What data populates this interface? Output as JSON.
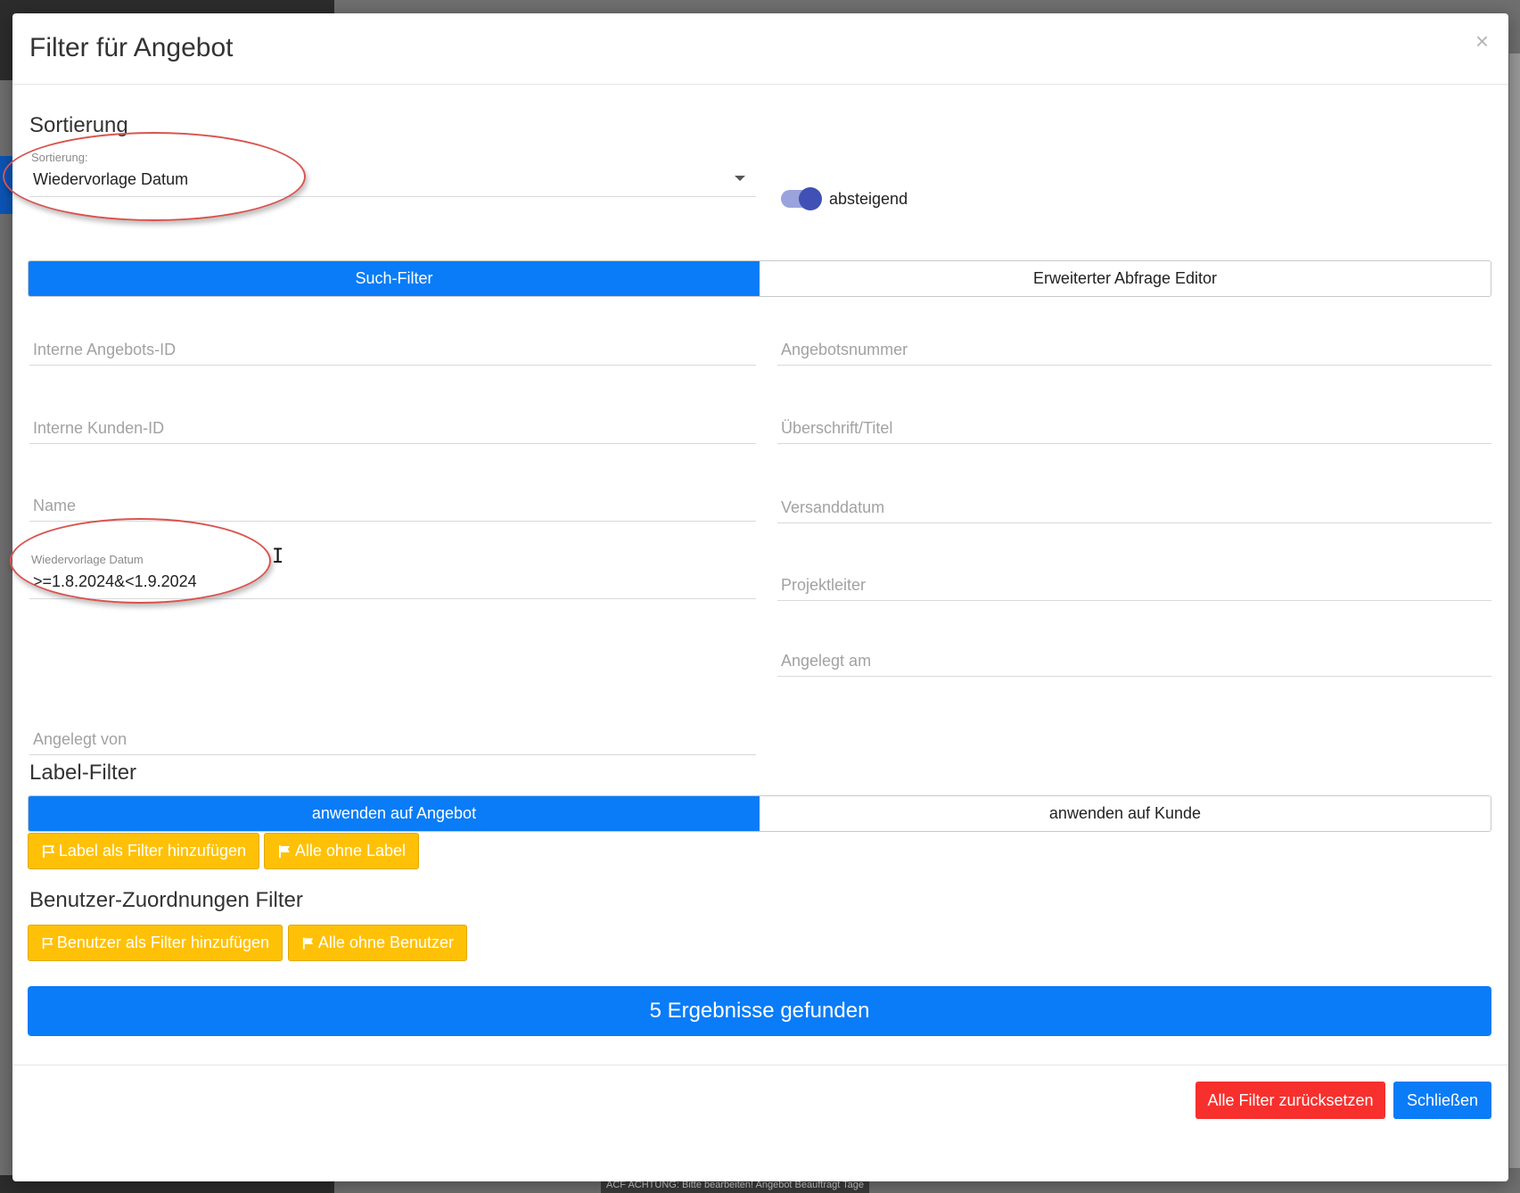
{
  "modal": {
    "title": "Filter für Angebot",
    "close_glyph": "×"
  },
  "sorting": {
    "section_title": "Sortierung",
    "field_label": "Sortierung:",
    "selected_value": "Wiedervorlage Datum",
    "descending_toggle_on": true,
    "descending_label": "absteigend"
  },
  "search_tabs": [
    {
      "label": "Such-Filter",
      "active": true
    },
    {
      "label": "Erweiterter Abfrage Editor",
      "active": false
    }
  ],
  "filter_fields": {
    "internal_offer_id": "Interne Angebots-ID",
    "offer_number": "Angebotsnummer",
    "internal_customer_id": "Interne Kunden-ID",
    "heading_title": "Überschrift/Titel",
    "name": "Name",
    "shipping_date": "Versanddatum",
    "followup_date_label": "Wiedervorlage Datum",
    "followup_date_value": ">=1.8.2024&<1.9.2024",
    "project_lead": "Projektleiter",
    "created_on": "Angelegt am",
    "created_by": "Angelegt von"
  },
  "label_filter": {
    "section_title": "Label-Filter",
    "tabs": [
      {
        "label": "anwenden auf Angebot",
        "active": true
      },
      {
        "label": "anwenden auf Kunde",
        "active": false
      }
    ],
    "add_label_button": "Label als Filter hinzufügen",
    "all_without_label_button": "Alle ohne Label"
  },
  "user_filter": {
    "section_title": "Benutzer-Zuordnungen Filter",
    "add_user_button": "Benutzer als Filter hinzufügen",
    "all_without_user_button": "Alle ohne Benutzer"
  },
  "results_button": "5 Ergebnisse gefunden",
  "footer": {
    "reset_button": "Alle Filter zurücksetzen",
    "close_button": "Schließen"
  },
  "background": {
    "status_text": "ACF   ACHTUNG: Bitte bearbeiten! Angebot Beauftragt  Tage"
  },
  "colors": {
    "primary": "#0a7cf7",
    "warning": "#ffc107",
    "danger": "#f7302d",
    "toggle_knob": "#3f51b5",
    "annotation": "#d9534f"
  }
}
